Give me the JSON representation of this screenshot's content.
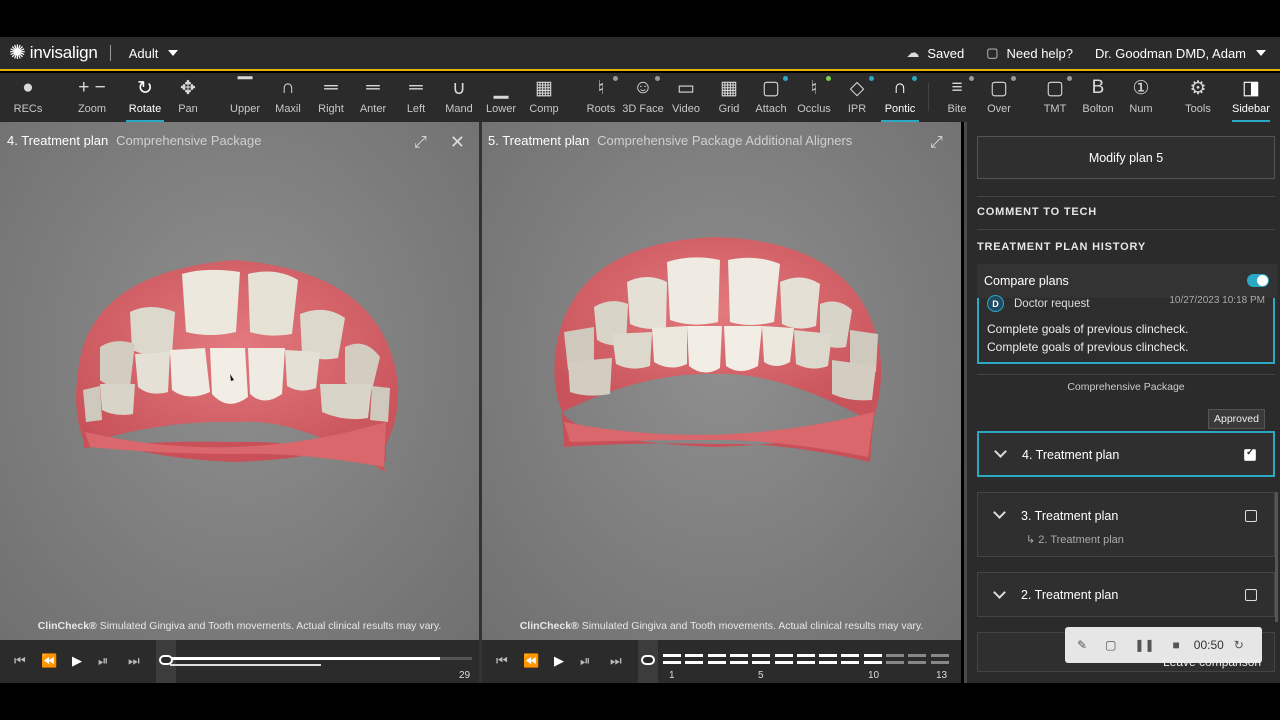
{
  "header": {
    "brand": "invisalign",
    "patient_type": "Adult",
    "saved": "Saved",
    "help": "Need help?",
    "user": "Dr. Goodman DMD, Adam"
  },
  "toolbar": [
    {
      "label": "RECs",
      "icon": "person-icon",
      "glyph": "●"
    },
    {
      "label": "Zoom",
      "icon": "zoom-icon",
      "glyph": "+ −"
    },
    {
      "label": "Rotate",
      "icon": "rotate-icon",
      "glyph": "↻"
    },
    {
      "label": "Pan",
      "icon": "pan-icon",
      "glyph": "✥"
    },
    {
      "label": "Upper",
      "icon": "upper-icon",
      "glyph": "▔"
    },
    {
      "label": "Maxil",
      "icon": "maxil-icon",
      "glyph": "∩"
    },
    {
      "label": "Right",
      "icon": "right-icon",
      "glyph": "═"
    },
    {
      "label": "Anter",
      "icon": "anter-icon",
      "glyph": "═"
    },
    {
      "label": "Left",
      "icon": "left-icon",
      "glyph": "═"
    },
    {
      "label": "Mand",
      "icon": "mand-icon",
      "glyph": "∪"
    },
    {
      "label": "Lower",
      "icon": "lower-icon",
      "glyph": "▁"
    },
    {
      "label": "Comp",
      "icon": "comp-icon",
      "glyph": "▦"
    },
    {
      "label": "Roots",
      "icon": "roots-icon",
      "glyph": "♮"
    },
    {
      "label": "3D Face",
      "icon": "face-icon",
      "glyph": "☺"
    },
    {
      "label": "Video",
      "icon": "video-icon",
      "glyph": "▭"
    },
    {
      "label": "Grid",
      "icon": "grid-icon",
      "glyph": "▦"
    },
    {
      "label": "Attach",
      "icon": "attach-icon",
      "glyph": "▢"
    },
    {
      "label": "Occlus",
      "icon": "occlus-icon",
      "glyph": "♮"
    },
    {
      "label": "IPR",
      "icon": "ipr-icon",
      "glyph": "◇"
    },
    {
      "label": "Pontic",
      "icon": "pontic-icon",
      "glyph": "∩"
    },
    {
      "label": "Bite",
      "icon": "bite-icon",
      "glyph": "≡"
    },
    {
      "label": "Over",
      "icon": "over-icon",
      "glyph": "▢"
    },
    {
      "label": "TMT",
      "icon": "tmt-icon",
      "glyph": "▢"
    },
    {
      "label": "Bolton",
      "icon": "bolton-icon",
      "glyph": "B"
    },
    {
      "label": "Num",
      "icon": "num-icon",
      "glyph": "①"
    },
    {
      "label": "Tools",
      "icon": "gear-icon",
      "glyph": "⚙"
    },
    {
      "label": "Sidebar",
      "icon": "sidebar-icon",
      "glyph": "◨"
    }
  ],
  "viewport_left": {
    "title_num": "4. Treatment plan",
    "title_pkg": "Comprehensive Package",
    "disclaimer_brand": "ClinCheck®",
    "disclaimer": "Simulated Gingiva and Tooth movements. Actual clinical results may vary."
  },
  "viewport_right": {
    "title_num": "5. Treatment plan",
    "title_pkg": "Comprehensive Package Additional Aligners",
    "disclaimer_brand": "ClinCheck®",
    "disclaimer": "Simulated Gingiva and Tooth movements. Actual clinical results may vary."
  },
  "playback_left": {
    "end_label": "29",
    "progress": 0.5
  },
  "playback_right": {
    "labels": [
      "1",
      "5",
      "10",
      "13"
    ]
  },
  "sidebar": {
    "modify_label": "Modify plan 5",
    "comment_heading": "COMMENT TO TECH",
    "history_heading": "TREATMENT PLAN HISTORY",
    "compare_label": "Compare plans",
    "request_avatar": "D",
    "request_title": "Doctor request",
    "request_date": "10/27/2023 10:18 PM",
    "request_lines": [
      "Complete goals of previous clincheck.",
      "Complete goals of previous clincheck."
    ],
    "package_caption": "Comprehensive Package",
    "approved_tip": "Approved",
    "plans": [
      {
        "title": "4. Treatment plan",
        "checked": true,
        "sub": ""
      },
      {
        "title": "3. Treatment plan",
        "checked": false,
        "sub": "2. Treatment plan"
      },
      {
        "title": "2. Treatment plan",
        "checked": false,
        "sub": ""
      }
    ]
  },
  "recorder": {
    "time": "00:50",
    "leave_label": "Leave comparison"
  },
  "colors": {
    "accent": "#2aa8c4",
    "header_rule": "#e0b400",
    "gum": "#d9676c",
    "tooth": "#ece8de"
  }
}
